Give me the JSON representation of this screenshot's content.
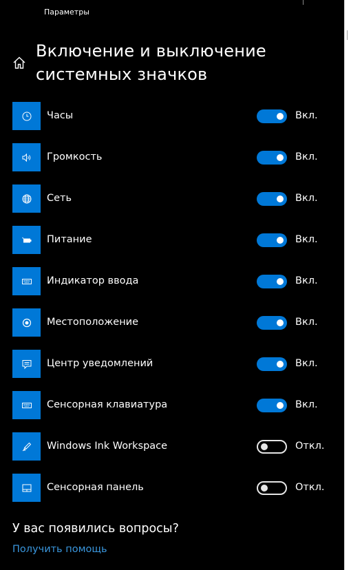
{
  "window": {
    "app_title": "Параметры"
  },
  "page": {
    "title_line1": "Включение и выключение",
    "title_line2": "системных значков"
  },
  "items": [
    {
      "label": "Часы",
      "icon": "clock-icon",
      "state": "Вкл.",
      "on": true
    },
    {
      "label": "Громкость",
      "icon": "volume-icon",
      "state": "Вкл.",
      "on": true
    },
    {
      "label": "Сеть",
      "icon": "globe-icon",
      "state": "Вкл.",
      "on": true
    },
    {
      "label": "Питание",
      "icon": "battery-icon",
      "state": "Вкл.",
      "on": true
    },
    {
      "label": "Индикатор ввода",
      "icon": "keyboard-icon",
      "state": "Вкл.",
      "on": true
    },
    {
      "label": "Местоположение",
      "icon": "location-icon",
      "state": "Вкл.",
      "on": true
    },
    {
      "label": "Центр уведомлений",
      "icon": "action-center-icon",
      "state": "Вкл.",
      "on": true
    },
    {
      "label": "Сенсорная клавиатура",
      "icon": "touch-keyboard-icon",
      "state": "Вкл.",
      "on": true
    },
    {
      "label": "Windows Ink Workspace",
      "icon": "pen-icon",
      "state": "Откл.",
      "on": false
    },
    {
      "label": "Сенсорная панель",
      "icon": "touchpad-icon",
      "state": "Откл.",
      "on": false
    }
  ],
  "help": {
    "heading": "У вас появились вопросы?",
    "link": "Получить помощь"
  },
  "colors": {
    "accent": "#0078d7",
    "link": "#3a96dd",
    "background": "#000000",
    "text": "#ffffff"
  }
}
